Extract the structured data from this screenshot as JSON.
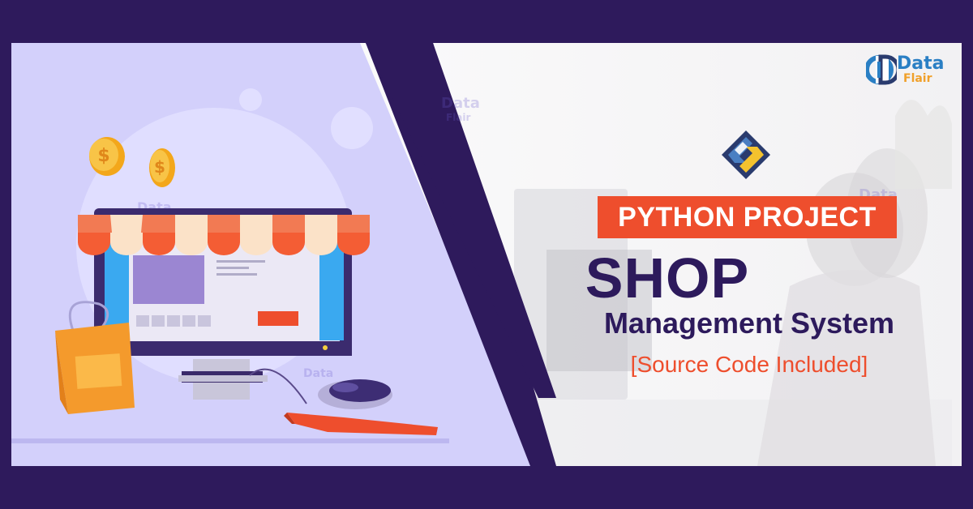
{
  "brand": {
    "logo_line1": "Data",
    "logo_line2": "Flair",
    "colors": {
      "blue": "#2a7fc4",
      "orange": "#f0a02a"
    }
  },
  "banner": {
    "tag": "PYTHON PROJECT",
    "title": "SHOP",
    "subtitle": "Management System",
    "note": "[Source Code Included]"
  },
  "colors": {
    "frame": "#2e1a5c",
    "accent": "#ee4e2d",
    "title": "#2d1a5c",
    "left_bg": "#d3d0fb"
  },
  "icons": [
    "coin-icon",
    "shopping-bag-icon",
    "mouse-icon",
    "keyboard-icon",
    "python-diamond-logo",
    "monitor-illustration"
  ]
}
